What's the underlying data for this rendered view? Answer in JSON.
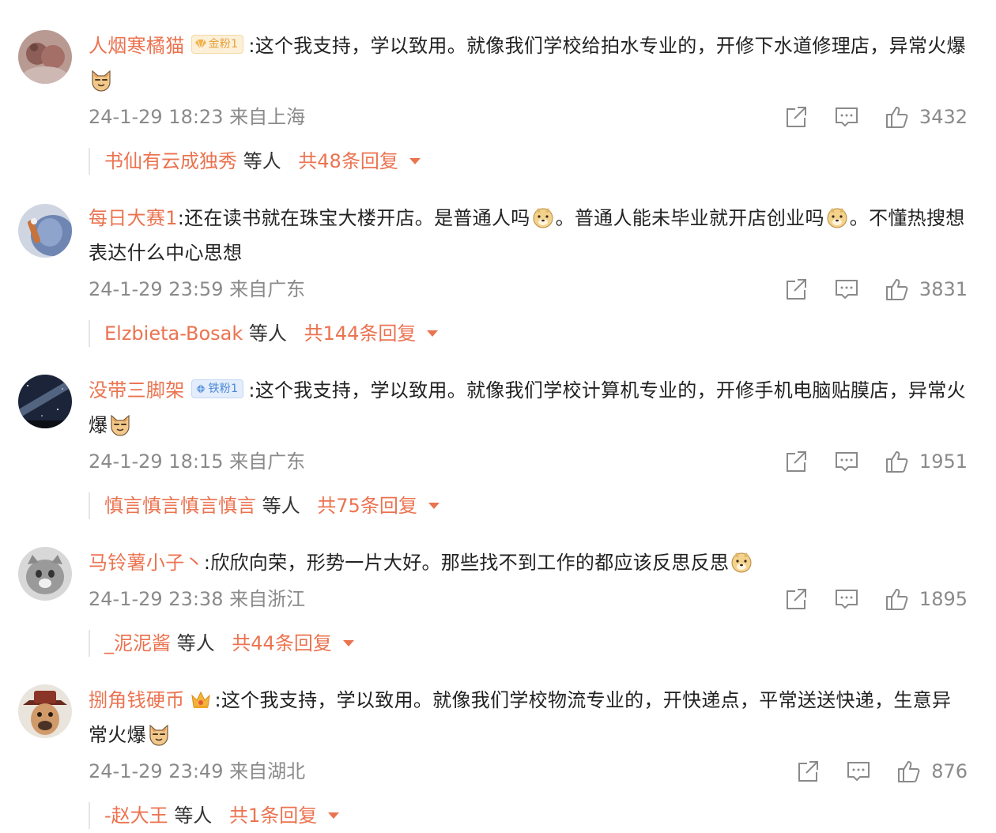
{
  "comments": [
    {
      "username": "人烟寒橘猫",
      "badge": "金粉1",
      "badge_type": "gold",
      "text": ":这个我支持，学以致用。就像我们学校给拍水专业的，开修下水道修理店，异常火爆",
      "emoji": "cat-face-icon",
      "time_location": "24-1-29 18:23 来自上海",
      "likes": "3432",
      "reply_user": "书仙有云成独秀",
      "reply_others": "等人",
      "reply_count": "共48条回复"
    },
    {
      "username": "每日大赛1",
      "text_a": ":还在读书就在珠宝大楼开店。是普通人吗",
      "text_b": "。普通人能未毕业就开店创业吗",
      "text_c": "。不懂热搜想表达什么中心思想",
      "emoji": "doge-face-icon",
      "time_location": "24-1-29 23:59 来自广东",
      "likes": "3831",
      "reply_user": "Elzbieta-Bosak",
      "reply_others": "等人",
      "reply_count": "共144条回复"
    },
    {
      "username": "没带三脚架",
      "badge": "铁粉1",
      "badge_type": "iron",
      "text": ":这个我支持，学以致用。就像我们学校计算机专业的，开修手机电脑贴膜店，异常火爆",
      "emoji": "cat-face-icon",
      "time_location": "24-1-29 18:15 来自广东",
      "likes": "1951",
      "reply_user": "慎言慎言慎言慎言",
      "reply_others": "等人",
      "reply_count": "共75条回复"
    },
    {
      "username": "马铃薯小子丶",
      "text": ":欣欣向荣，形势一片大好。那些找不到工作的都应该反思反思",
      "emoji": "doge-face-icon",
      "time_location": "24-1-29 23:38 来自浙江",
      "likes": "1895",
      "reply_user": "_泥泥酱",
      "reply_others": "等人",
      "reply_count": "共44条回复"
    },
    {
      "username": "捌角钱硬币",
      "text": ":这个我支持，学以致用。就像我们学校物流专业的，开快递点，平常送送快递，生意异常火爆",
      "emoji": "cat-face-icon",
      "time_location": "24-1-29 23:49 来自湖北",
      "likes": "876",
      "reply_user": "-赵大王",
      "reply_others": "等人",
      "reply_count": "共1条回复"
    }
  ],
  "colors": {
    "accent": "#eb7350",
    "meta": "#8a8a8a",
    "text": "#222222"
  }
}
